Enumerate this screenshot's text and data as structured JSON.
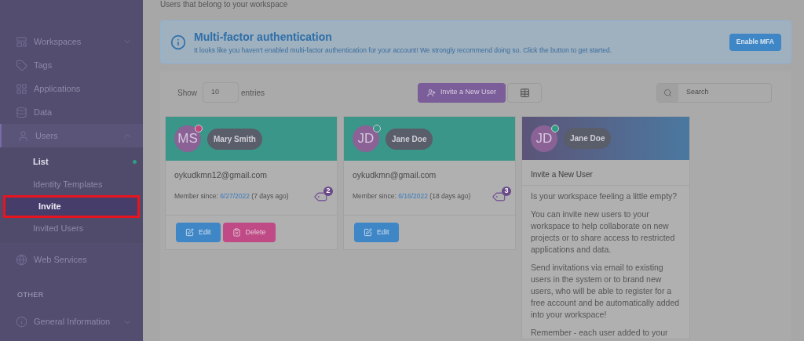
{
  "page": {
    "subtitle": "Users that belong to your workspace"
  },
  "sidebar": {
    "items": [
      {
        "label": "Workspaces",
        "expanded": false
      },
      {
        "label": "Tags"
      },
      {
        "label": "Applications"
      },
      {
        "label": "Data"
      },
      {
        "label": "Users",
        "expanded": true,
        "children": [
          {
            "label": "List",
            "selected": false,
            "current": true
          },
          {
            "label": "Identity Templates",
            "selected": false,
            "current": false
          },
          {
            "label": "Invite",
            "selected": true,
            "current": false
          },
          {
            "label": "Invited Users",
            "selected": false,
            "current": false
          }
        ]
      },
      {
        "label": "Web Services"
      }
    ],
    "section": "OTHER",
    "other_items": [
      {
        "label": "General Information",
        "expanded": false
      }
    ]
  },
  "alert": {
    "title": "Multi-factor authentication",
    "message": "It looks like you haven't enabled multi-factor authentication for your account! We strongly recommend doing so. Click the button to get started.",
    "button": "Enable MFA"
  },
  "toolbar": {
    "show_label": "Show",
    "entries_value": "10",
    "entries_label": "entries",
    "invite_button": "Invite a New User",
    "search": {
      "placeholder": "Search"
    }
  },
  "cards": [
    {
      "kind": "user",
      "initials": "MS",
      "name": "Mary Smith",
      "color": "#c2457e",
      "email": "oykudkmn12@gmail.com",
      "member_label": "Member since:",
      "date": "6/27/2022",
      "ago": "(7 days ago)",
      "tag_count": "2",
      "buttons": [
        {
          "kind": "edit",
          "label": "Edit"
        },
        {
          "kind": "delete",
          "label": "Delete"
        }
      ]
    },
    {
      "kind": "user",
      "initials": "JD",
      "name": "Jane Doe",
      "color": "#3a9688",
      "email": "oykudkmn@gmail.com",
      "member_label": "Member since:",
      "date": "6/16/2022",
      "ago": "(18 days ago)",
      "tag_count": "3",
      "buttons": [
        {
          "kind": "edit",
          "label": "Edit"
        }
      ]
    },
    {
      "kind": "invite",
      "initials": "JD",
      "name": "Jane Doe",
      "color": "#2f9d85",
      "title": "Invite a New User",
      "paragraphs": [
        "Is your workspace feeling a little empty?",
        "You can invite new users to your workspace to help collaborate on new projects or to share access to restricted applications and data.",
        "Send invitations via email to existing users in the system or to brand new users, who will be able to register for a free account and be automatically added into your workspace!",
        "Remember - each user added to your"
      ]
    }
  ]
}
